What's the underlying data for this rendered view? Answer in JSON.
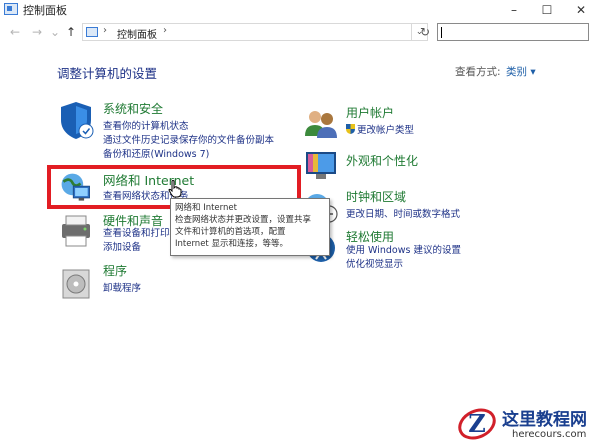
{
  "window": {
    "title": "控制面板",
    "minimize": "–",
    "maximize": "☐",
    "close": "✕"
  },
  "address_bar": {
    "back": "←",
    "forward": "→",
    "recent": "⌄",
    "up": "↑",
    "crumb": "控制面板",
    "separator": "›",
    "separator2": "›",
    "dropdown": "⌄",
    "refresh": "↻",
    "search_placeholder": ""
  },
  "main": {
    "heading": "调整计算机的设置",
    "view_by_label": "查看方式:",
    "view_by_value": "类别 ▾"
  },
  "categories_left": [
    {
      "title": "系统和安全",
      "links": [
        "查看你的计算机状态",
        "通过文件历史记录保存你的文件备份副本",
        "备份和还原(Windows 7)"
      ]
    },
    {
      "title": "网络和 Internet",
      "links": [
        "查看网络状态和任务"
      ]
    },
    {
      "title": "硬件和声音",
      "links": [
        "查看设备和打印机",
        "添加设备"
      ]
    },
    {
      "title": "程序",
      "links": [
        "卸载程序"
      ]
    }
  ],
  "categories_right": [
    {
      "title": "用户帐户",
      "links": [
        "更改帐户类型"
      ]
    },
    {
      "title": "外观和个性化",
      "links": []
    },
    {
      "title": "时钟和区域",
      "links": [
        "更改日期、时间或数字格式"
      ]
    },
    {
      "title": "轻松使用",
      "links": [
        "使用 Windows 建议的设置",
        "优化视觉显示"
      ]
    }
  ],
  "tooltip": {
    "lines": [
      "网络和 Internet",
      "检查网络状态并更改设置，设置共享",
      "文件和计算机的首选项，配置",
      "Internet 显示和连接，等等。"
    ]
  },
  "watermark": {
    "title": "这里教程网",
    "url": "herecours.com",
    "logo_letter": "Z"
  },
  "colors": {
    "category_title": "#1f7a33",
    "link": "#1e3287",
    "highlight": "#e21d23"
  }
}
